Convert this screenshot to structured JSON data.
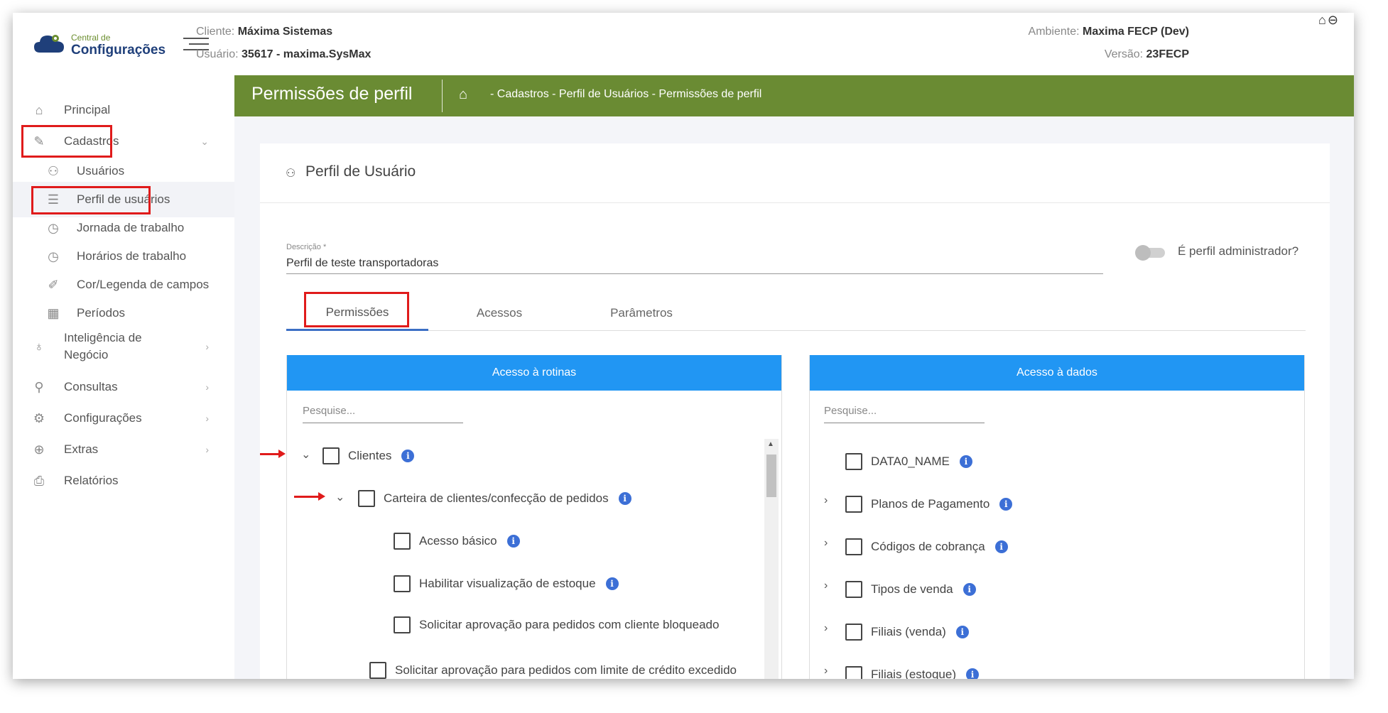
{
  "header": {
    "logo_small": "Central de",
    "logo_big": "Configurações",
    "client_label": "Cliente:",
    "client_value": "Máxima Sistemas",
    "user_label": "Usuário:",
    "user_value": "35617 - maxima.SysMax",
    "env_label": "Ambiente:",
    "env_value": "Maxima FECP (Dev)",
    "version_label": "Versão:",
    "version_value": "23FECP",
    "icons": "⌂⊖"
  },
  "sidebar": {
    "items": [
      {
        "label": "Principal",
        "icon": "home-icon"
      },
      {
        "label": "Cadastros",
        "icon": "edit-icon"
      },
      {
        "label": "Usuários",
        "icon": "users-icon"
      },
      {
        "label": "Perfil de usuários",
        "icon": "checklist-icon"
      },
      {
        "label": "Jornada de trabalho",
        "icon": "clock-icon"
      },
      {
        "label": "Horários de trabalho",
        "icon": "clock-icon"
      },
      {
        "label": "Cor/Legenda de campos",
        "icon": "pen-icon"
      },
      {
        "label": "Períodos",
        "icon": "calendar-icon"
      },
      {
        "label": "Inteligência de",
        "label2": "Negócio",
        "icon": "bulb-icon"
      },
      {
        "label": "Consultas",
        "icon": "search-icon"
      },
      {
        "label": "Configurações",
        "icon": "gear-icon"
      },
      {
        "label": "Extras",
        "icon": "plus-circle-icon"
      },
      {
        "label": "Relatórios",
        "icon": "printer-icon"
      }
    ]
  },
  "titlebar": {
    "title": "Permissões de perfil",
    "breadcrumb": "- Cadastros - Perfil de Usuários - Permissões de perfil"
  },
  "card": {
    "title": "Perfil de Usuário",
    "description_label": "Descrição *",
    "description_value": "Perfil de teste transportadoras",
    "admin_label": "É perfil administrador?"
  },
  "tabs": [
    "Permissões",
    "Acessos",
    "Parâmetros"
  ],
  "routines_panel": {
    "header": "Acesso à rotinas",
    "search_placeholder": "Pesquise...",
    "items": [
      "Clientes",
      "Carteira de clientes/confecção de pedidos",
      "Acesso básico",
      "Habilitar visualização de estoque",
      "Solicitar aprovação para pedidos com cliente bloqueado",
      "Solicitar aprovação para pedidos com limite de crédito excedido"
    ]
  },
  "data_panel": {
    "header": "Acesso à dados",
    "search_placeholder": "Pesquise...",
    "items": [
      "DATA0_NAME",
      "Planos de Pagamento",
      "Códigos de cobrança",
      "Tipos de venda",
      "Filiais (venda)",
      "Filiais (estoque)"
    ]
  },
  "colors": {
    "green_bar": "#6a8b33",
    "panel_header": "#2196f3",
    "highlight_red": "#e01b1b",
    "info_blue": "#3c6fd6"
  }
}
